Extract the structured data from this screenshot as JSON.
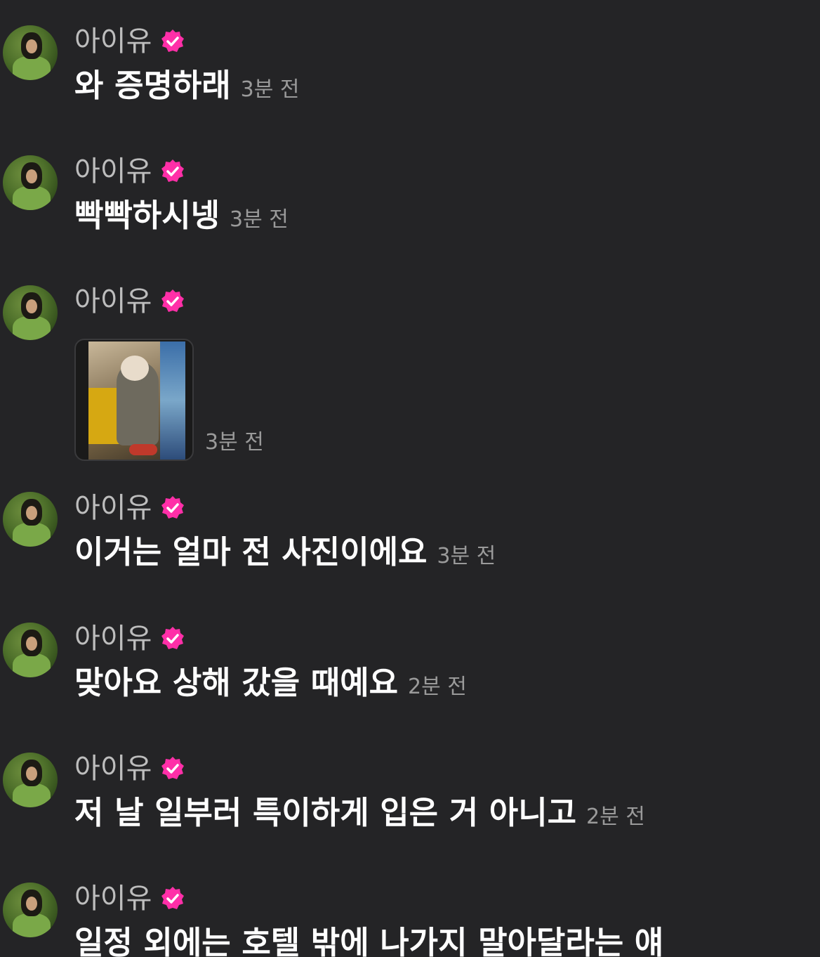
{
  "colors": {
    "background": "#242426",
    "name_text": "#bdbdbd",
    "message_text": "#ffffff",
    "timestamp_text": "#9a9a9a",
    "verified_badge": "#ff2fa8"
  },
  "messages": [
    {
      "sender": "아이유",
      "badge_icon": "verified-badge-icon",
      "text": "와 증명하래",
      "time": "3분 전"
    },
    {
      "sender": "아이유",
      "badge_icon": "verified-badge-icon",
      "text": "빡빡하시넹",
      "time": "3분 전"
    },
    {
      "sender": "아이유",
      "badge_icon": "verified-badge-icon",
      "image": "photo-thumbnail",
      "time": "3분 전"
    },
    {
      "sender": "아이유",
      "badge_icon": "verified-badge-icon",
      "text": "이거는 얼마 전 사진이에요",
      "time": "3분 전"
    },
    {
      "sender": "아이유",
      "badge_icon": "verified-badge-icon",
      "text": "맞아요 상해 갔을 때예요",
      "time": "2분 전"
    },
    {
      "sender": "아이유",
      "badge_icon": "verified-badge-icon",
      "text": "저 날 일부러 특이하게 입은 거 아니고",
      "time": "2분 전"
    },
    {
      "sender": "아이유",
      "badge_icon": "verified-badge-icon",
      "text": "일정 외에는 호텔 밖에 나가지 말아달라는 얘",
      "time": ""
    }
  ]
}
